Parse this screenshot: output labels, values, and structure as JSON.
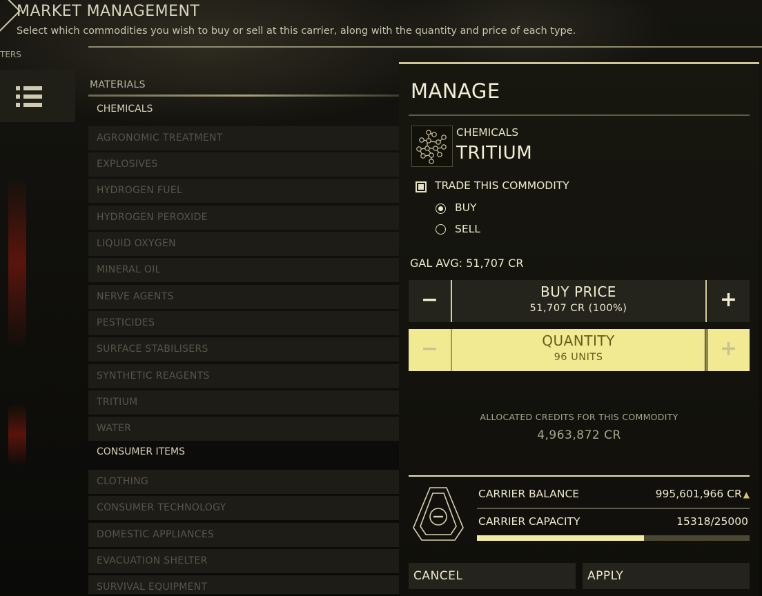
{
  "header": {
    "title": "MARKET MANAGEMENT",
    "subtitle": "Select which commodities you wish to buy or sell at this carrier, along with the quantity and price of each type.",
    "filters_label": "TERS"
  },
  "list": {
    "section_label": "MATERIALS",
    "groups": [
      {
        "category": "CHEMICALS",
        "items": [
          "AGRONOMIC TREATMENT",
          "EXPLOSIVES",
          "HYDROGEN FUEL",
          "HYDROGEN PEROXIDE",
          "LIQUID OXYGEN",
          "MINERAL OIL",
          "NERVE AGENTS",
          "PESTICIDES",
          "SURFACE STABILISERS",
          "SYNTHETIC REAGENTS",
          "TRITIUM",
          "WATER"
        ]
      },
      {
        "category": "CONSUMER ITEMS",
        "items": [
          "CLOTHING",
          "CONSUMER TECHNOLOGY",
          "DOMESTIC APPLIANCES",
          "EVACUATION SHELTER",
          "SURVIVAL EQUIPMENT"
        ]
      }
    ]
  },
  "panel": {
    "title": "MANAGE",
    "commodity_category": "CHEMICALS",
    "commodity_name": "TRITIUM",
    "trade_label": "TRADE THIS COMMODITY",
    "trade_checked": true,
    "buy_label": "BUY",
    "sell_label": "SELL",
    "selected_mode": "BUY",
    "gal_avg": "GAL AVG: 51,707 CR",
    "price": {
      "title": "BUY PRICE",
      "value": "51,707 CR (100%)",
      "minus": "−",
      "plus": "+"
    },
    "quantity": {
      "title": "QUANTITY",
      "value": "96 UNITS",
      "minus": "−",
      "plus": "+"
    },
    "allocated_label": "ALLOCATED CREDITS FOR THIS COMMODITY",
    "allocated_value": "4,963,872 CR",
    "carrier_balance_label": "CARRIER BALANCE",
    "carrier_balance_value": "995,601,966 CR",
    "carrier_capacity_label": "CARRIER CAPACITY",
    "carrier_capacity_value": "15318/25000",
    "capacity_fraction": 0.61272,
    "cancel_label": "CANCEL",
    "apply_label": "APPLY"
  },
  "colors": {
    "accent": "#f2ea93",
    "panel_border": "#cfc79a",
    "text": "#ece9cd"
  }
}
